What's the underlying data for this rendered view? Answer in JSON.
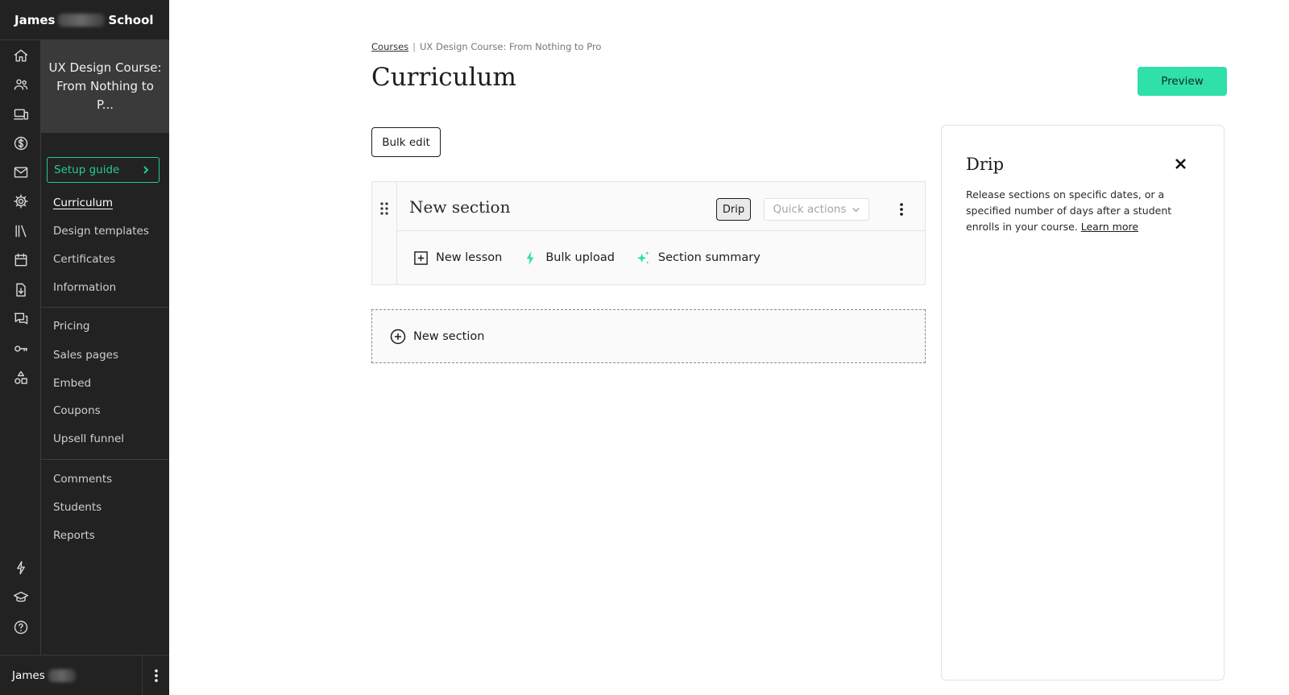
{
  "school": {
    "first": "James",
    "last": "School"
  },
  "course": {
    "title": "UX Design Course: From Nothing to P..."
  },
  "rail_icons": [
    "home-icon",
    "users-icon",
    "devices-icon",
    "dollar-icon",
    "mail-icon",
    "gear-icon",
    "library-icon",
    "calendar-icon",
    "download-file-icon",
    "chat-icon",
    "key-icon",
    "shapes-icon",
    "lightning-icon",
    "graduation-cap-icon",
    "help-icon"
  ],
  "setup_guide": {
    "label": "Setup guide"
  },
  "nav": {
    "group1": [
      "Curriculum",
      "Design templates",
      "Certificates",
      "Information"
    ],
    "group2": [
      "Pricing",
      "Sales pages",
      "Embed",
      "Coupons",
      "Upsell funnel"
    ],
    "group3": [
      "Comments",
      "Students",
      "Reports"
    ],
    "active": "Curriculum"
  },
  "user": {
    "name": "James"
  },
  "breadcrumb": {
    "link": "Courses",
    "separator": "|",
    "current": "UX Design Course: From Nothing to Pro"
  },
  "page": {
    "title": "Curriculum",
    "preview_label": "Preview",
    "bulk_edit_label": "Bulk edit"
  },
  "section": {
    "name": "New section",
    "drip_badge": "Drip",
    "quick_actions": "Quick actions",
    "actions": {
      "new_lesson": "New lesson",
      "bulk_upload": "Bulk upload",
      "summary": "Section summary"
    }
  },
  "new_section_label": "New section",
  "drip_panel": {
    "title": "Drip",
    "description": "Release sections on specific dates, or a specified number of days after a student enrolls in your course.",
    "link": "Learn more"
  },
  "colors": {
    "sidebar": "#222222",
    "accent": "#2fe0a8",
    "accent_text": "#27c79a"
  }
}
